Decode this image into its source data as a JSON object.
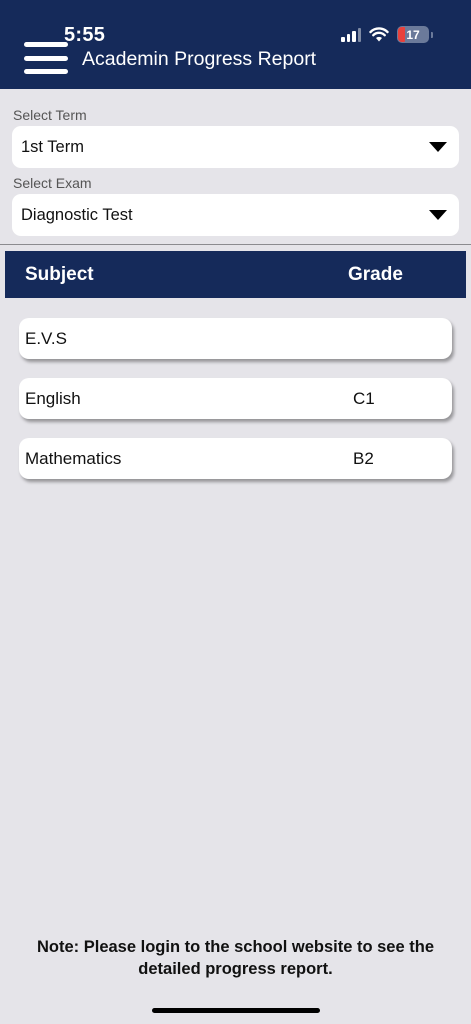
{
  "status_bar": {
    "time": "5:55",
    "battery_level": "17",
    "icons": [
      "cellular-signal-icon",
      "wifi-icon",
      "battery-icon"
    ]
  },
  "header": {
    "menu_icon": "hamburger-menu-icon",
    "title": "Academin Progress Report"
  },
  "filters": {
    "term": {
      "label": "Select Term",
      "value": "1st Term"
    },
    "exam": {
      "label": "Select Exam",
      "value": "Diagnostic Test"
    }
  },
  "table": {
    "columns": {
      "subject": "Subject",
      "grade": "Grade"
    },
    "rows": [
      {
        "subject": "E.V.S",
        "grade": ""
      },
      {
        "subject": "English",
        "grade": "C1"
      },
      {
        "subject": "Mathematics",
        "grade": "B2"
      }
    ]
  },
  "footer": {
    "note": "Note: Please login to the school website to see the detailed progress report."
  },
  "colors": {
    "header_bg": "#152a5a",
    "page_bg": "#e5e4e9",
    "battery_low": "#e8413c"
  }
}
